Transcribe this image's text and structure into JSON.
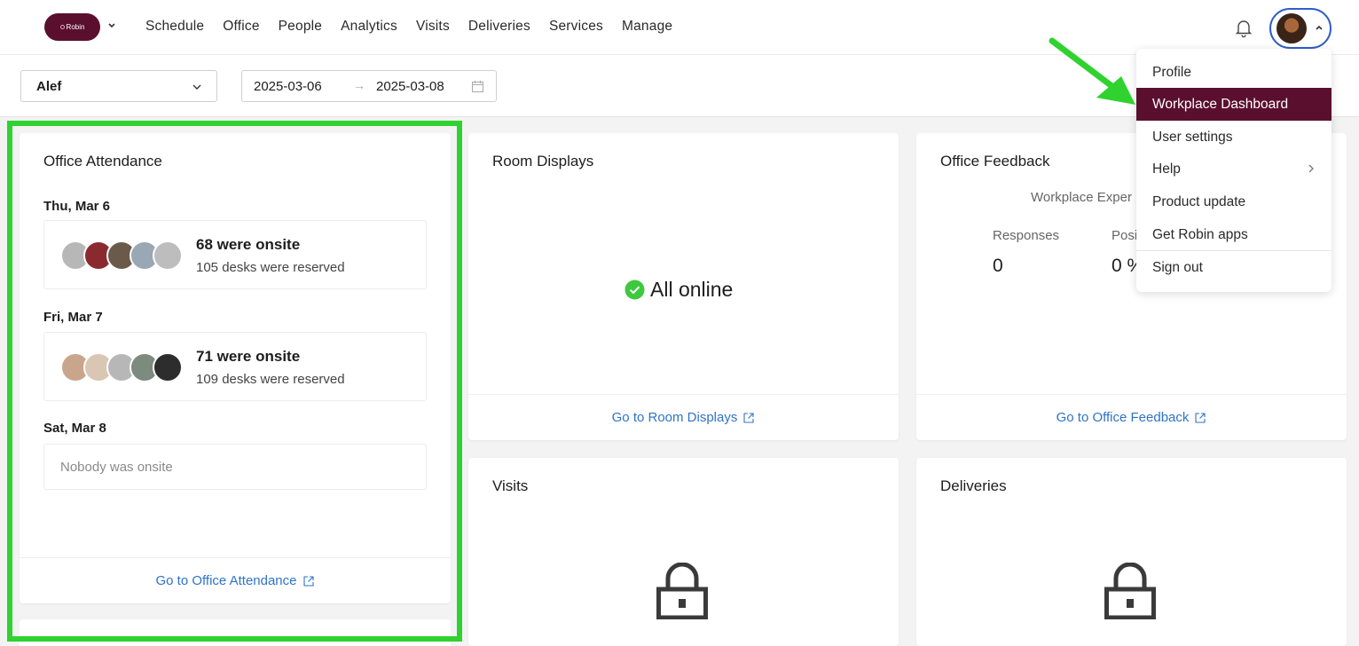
{
  "nav": {
    "logo_text": "Robin",
    "links": [
      "Schedule",
      "Office",
      "People",
      "Analytics",
      "Visits",
      "Deliveries",
      "Services",
      "Manage"
    ]
  },
  "filters": {
    "location": "Alef",
    "date_start": "2025-03-06",
    "date_end": "2025-03-08",
    "arrow": "→"
  },
  "attendance": {
    "title": "Office Attendance",
    "days": [
      {
        "label": "Thu, Mar 6",
        "onsite": "68 were onsite",
        "desks": "105 desks were reserved"
      },
      {
        "label": "Fri, Mar 7",
        "onsite": "71 were onsite",
        "desks": "109 desks were reserved"
      },
      {
        "label": "Sat, Mar 8",
        "empty": "Nobody was onsite"
      }
    ],
    "footer": "Go to Office Attendance"
  },
  "room_displays": {
    "title": "Room Displays",
    "status": "All online",
    "footer": "Go to Room Displays"
  },
  "feedback": {
    "title": "Office Feedback",
    "subtitle": "Workplace Exper",
    "col1_label": "Responses",
    "col2_label": "Posi",
    "col1_value": "0",
    "col2_value": "0 %",
    "footer": "Go to Office Feedback"
  },
  "visits": {
    "title": "Visits"
  },
  "deliveries": {
    "title": "Deliveries"
  },
  "menu": {
    "items": [
      "Profile",
      "Workplace Dashboard",
      "User settings",
      "Help",
      "Product update",
      "Get Robin apps",
      "Sign out"
    ],
    "active_index": 1
  },
  "colors": {
    "brand": "#5a0f2e",
    "link": "#2f73c9",
    "highlight": "#2fd22f",
    "online": "#3ec83e"
  }
}
